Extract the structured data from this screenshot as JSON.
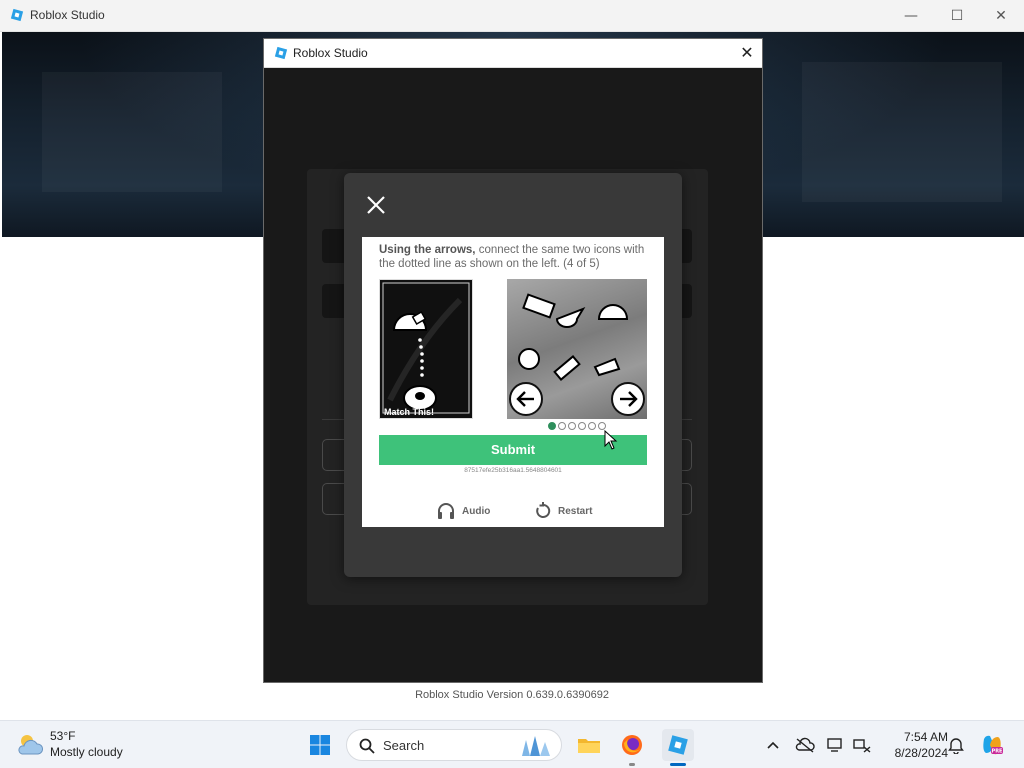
{
  "main_window": {
    "title": "Roblox Studio",
    "controls": {
      "minimize": "—",
      "maximize": "☐",
      "close": "✕"
    },
    "version": "Roblox Studio Version 0.639.0.6390692"
  },
  "dialog": {
    "title": "Roblox Studio",
    "close": "✕"
  },
  "captcha": {
    "instruction_bold": "Using the arrows,",
    "instruction_rest": " connect the same two icons with the dotted line as shown on the left. (4 of 5)",
    "match_label": "Match This!",
    "submit_label": "Submit",
    "session_id": "87517efe25b316aa1.5648804601",
    "audio_label": "Audio",
    "restart_label": "Restart",
    "progress": {
      "total": 6,
      "current": 1
    },
    "colors": {
      "submit": "#3ec27a",
      "active_dot": "#2e8f5c",
      "modal_bg": "#393939"
    }
  },
  "taskbar": {
    "weather": {
      "temp": "53°F",
      "desc": "Mostly cloudy",
      "icon": "cloud-sun-icon"
    },
    "search_label": "Search",
    "clock": {
      "time": "7:54 AM",
      "date": "8/28/2024"
    },
    "apps": [
      "windows-start-icon",
      "file-explorer-icon",
      "firefox-icon",
      "roblox-studio-icon"
    ],
    "tray": [
      "chevron-up-icon",
      "onedrive-offline-icon",
      "display-icon",
      "network-icon",
      "notifications-icon",
      "copilot-icon"
    ]
  }
}
